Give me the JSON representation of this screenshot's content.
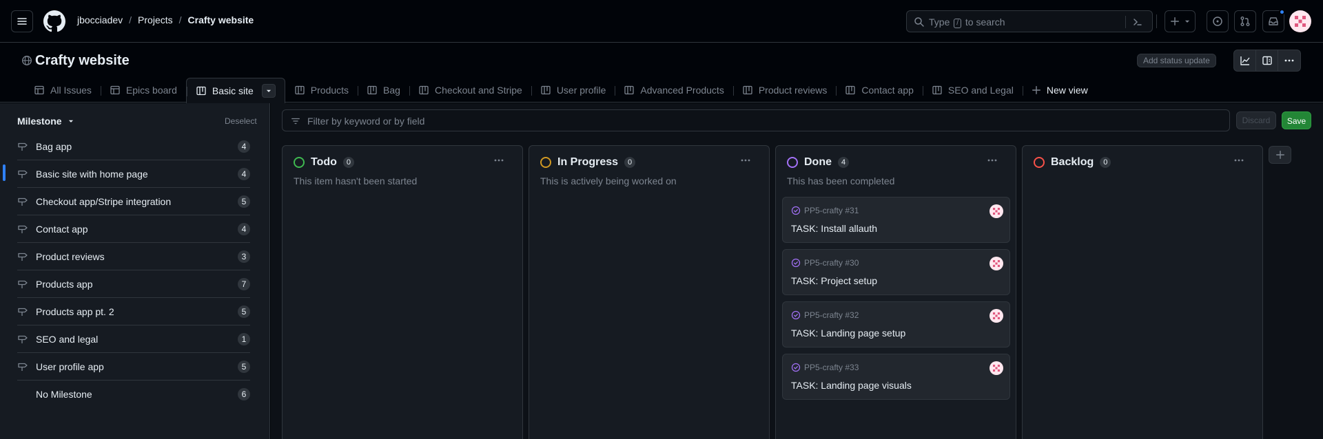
{
  "header": {
    "owner": "jbocciadev",
    "projects": "Projects",
    "project": "Crafty website",
    "search_prefix": "Type",
    "search_key": "/",
    "search_suffix": "to search"
  },
  "project": {
    "title": "Crafty website",
    "status_update_label": "Add status update"
  },
  "tabs": [
    {
      "label": "All Issues",
      "icon": "table-icon"
    },
    {
      "label": "Epics board",
      "icon": "table-icon"
    },
    {
      "label": "Basic site",
      "icon": "board-icon",
      "active": true
    },
    {
      "label": "Products",
      "icon": "board-icon"
    },
    {
      "label": "Bag",
      "icon": "board-icon"
    },
    {
      "label": "Checkout and Stripe",
      "icon": "board-icon"
    },
    {
      "label": "User profile",
      "icon": "board-icon"
    },
    {
      "label": "Advanced Products",
      "icon": "board-icon"
    },
    {
      "label": "Product reviews",
      "icon": "board-icon"
    },
    {
      "label": "Contact app",
      "icon": "board-icon"
    },
    {
      "label": "SEO and Legal",
      "icon": "board-icon"
    }
  ],
  "new_view_label": "New view",
  "sidebar": {
    "heading": "Milestone",
    "deselect_label": "Deselect",
    "items": [
      {
        "label": "Bag app",
        "count": "4"
      },
      {
        "label": "Basic site with home page",
        "count": "4",
        "selected": true
      },
      {
        "label": "Checkout app/Stripe integration",
        "count": "5"
      },
      {
        "label": "Contact app",
        "count": "4"
      },
      {
        "label": "Product reviews",
        "count": "3"
      },
      {
        "label": "Products app",
        "count": "7"
      },
      {
        "label": "Products app pt. 2",
        "count": "5"
      },
      {
        "label": "SEO and legal",
        "count": "1"
      },
      {
        "label": "User profile app",
        "count": "5"
      },
      {
        "label": "No Milestone",
        "count": "6",
        "no_icon": true
      }
    ]
  },
  "filter": {
    "placeholder": "Filter by keyword or by field",
    "discard_label": "Discard",
    "save_label": "Save"
  },
  "columns": [
    {
      "title": "Todo",
      "count": "0",
      "description": "This item hasn't been started",
      "color": "#3fb950",
      "cards": []
    },
    {
      "title": "In Progress",
      "count": "0",
      "description": "This is actively being worked on",
      "color": "#d29922",
      "cards": []
    },
    {
      "title": "Done",
      "count": "4",
      "description": "This has been completed",
      "color": "#a371f7",
      "cards": [
        {
          "ref": "PP5-crafty #31",
          "title": "TASK: Install allauth"
        },
        {
          "ref": "PP5-crafty #30",
          "title": "TASK: Project setup"
        },
        {
          "ref": "PP5-crafty #32",
          "title": "TASK: Landing page setup"
        },
        {
          "ref": "PP5-crafty #33",
          "title": "TASK: Landing page visuals"
        }
      ]
    },
    {
      "title": "Backlog",
      "count": "0",
      "description": "",
      "color": "#f85149",
      "cards": []
    }
  ],
  "colors": {
    "accent": "#2f81f7",
    "save_green": "#238636",
    "done_purple": "#a371f7"
  }
}
